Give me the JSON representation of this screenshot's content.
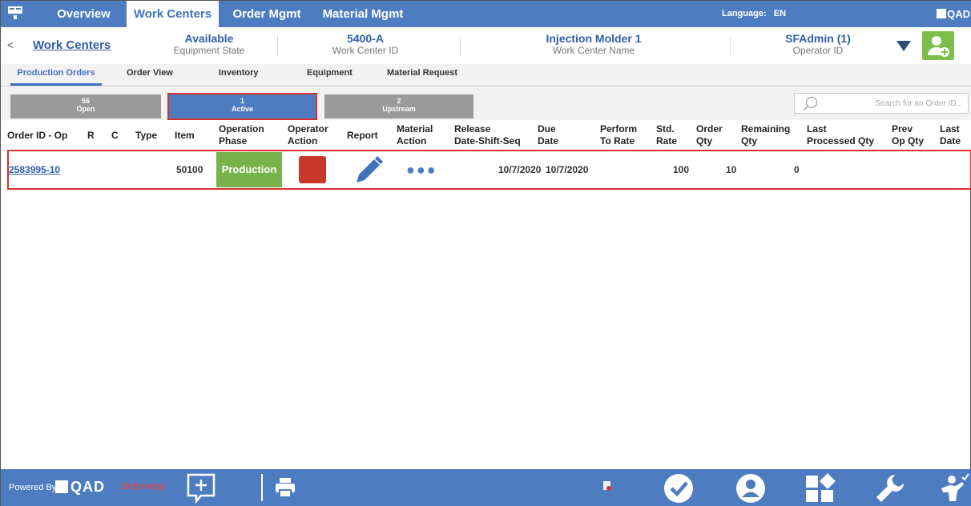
{
  "topbar": {
    "tabs": [
      "Overview",
      "Work Centers",
      "Order Mgmt",
      "Material Mgmt"
    ],
    "active_tab": "Work Centers",
    "language_label": "Language:",
    "language_value": "EN",
    "brand": "QAD"
  },
  "header": {
    "back": "<",
    "title_link": "Work Centers",
    "equipment_state": {
      "value": "Available",
      "label": "Equipment State"
    },
    "work_center_id": {
      "value": "5400-A",
      "label": "Work Center ID"
    },
    "work_center_name": {
      "value": "Injection Molder 1",
      "label": "Work Center Name"
    },
    "operator_id": {
      "value": "SFAdmin (1)",
      "label": "Operator ID"
    }
  },
  "subtabs": [
    "Production Orders",
    "Order View",
    "Inventory",
    "Equipment",
    "Material Request"
  ],
  "active_subtab": "Production Orders",
  "filters": {
    "open": {
      "count": "56",
      "label": "Open"
    },
    "active": {
      "count": "1",
      "label": "Active"
    },
    "upstream": {
      "count": "2",
      "label": "Upstream"
    },
    "search_placeholder": "Search for an Order ID..."
  },
  "table": {
    "columns": {
      "order_id": "Order ID - Op",
      "r": "R",
      "c": "C",
      "type": "Type",
      "item": "Item",
      "phase_1": "Operation",
      "phase_2": "Phase",
      "opact_1": "Operator",
      "opact_2": "Action",
      "report": "Report",
      "matact_1": "Material",
      "matact_2": "Action",
      "release_1": "Release",
      "release_2": "Date-Shift-Seq",
      "due_1": "Due",
      "due_2": "Date",
      "perform_1": "Perform",
      "perform_2": "To Rate",
      "std_1": "Std.",
      "std_2": "Rate",
      "oqty_1": "Order",
      "oqty_2": "Qty",
      "rem_1": "Remaining",
      "rem_2": "Qty",
      "lpq_1": "Last",
      "lpq_2": "Processed Qty",
      "prev_1": "Prev",
      "prev_2": "Op Qty",
      "ld_1": "Last",
      "ld_2": "Date"
    },
    "rows": [
      {
        "order_id": "2583995-10",
        "item": "50100",
        "phase": "Production",
        "material_action": "●●●",
        "release": "10/7/2020",
        "due": "10/7/2020",
        "std_rate": "100",
        "order_qty": "10",
        "remaining_qty": "0"
      }
    ]
  },
  "footer": {
    "powered_by": "Powered By",
    "brand": "QAD",
    "errors": "19 Error(s)"
  },
  "colors": {
    "primary": "#4d7dc0",
    "phase_green": "#77b24a",
    "operator_red": "#c8392b",
    "highlight_red": "#d63232"
  }
}
